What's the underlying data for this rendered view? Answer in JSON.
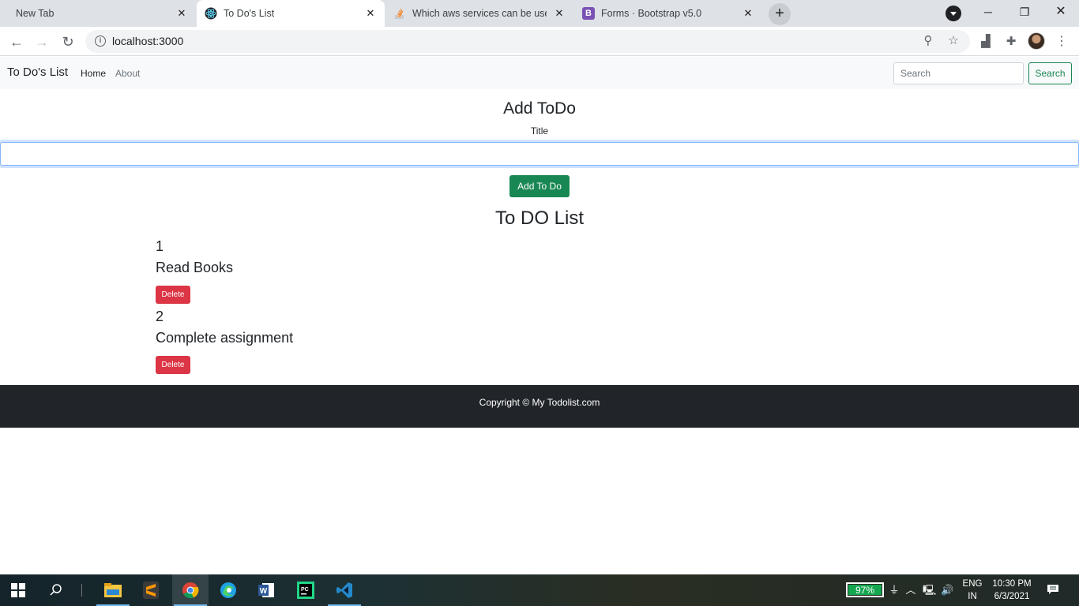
{
  "browser": {
    "tabs": [
      {
        "label": "New Tab",
        "icon": "none"
      },
      {
        "label": "To Do's List",
        "icon": "react-icon"
      },
      {
        "label": "Which aws services can be used t",
        "icon": "stackoverflow-icon"
      },
      {
        "label": "Forms · Bootstrap v5.0",
        "icon": "bootstrap-icon",
        "icon_glyph": "B"
      }
    ],
    "url": "localhost:3000"
  },
  "app": {
    "brand": "To Do's List",
    "nav": {
      "home": "Home",
      "about": "About"
    },
    "search": {
      "placeholder": "Search",
      "button": "Search"
    },
    "add_heading": "Add ToDo",
    "title_label": "Title",
    "add_button": "Add To Do",
    "list_heading": "To DO List",
    "todos": [
      {
        "sno": "1",
        "title": "Read Books",
        "delete": "Delete"
      },
      {
        "sno": "2",
        "title": "Complete assignment",
        "delete": "Delete"
      }
    ],
    "footer": "Copyright © My Todolist.com"
  },
  "taskbar": {
    "battery": "97%",
    "lang": "ENG",
    "region": "IN",
    "time": "10:30 PM",
    "date": "6/3/2021"
  },
  "colors": {
    "success": "#198754",
    "danger": "#dc3545",
    "footer_bg": "#212529",
    "navbar_bg": "#f8f9fa"
  }
}
